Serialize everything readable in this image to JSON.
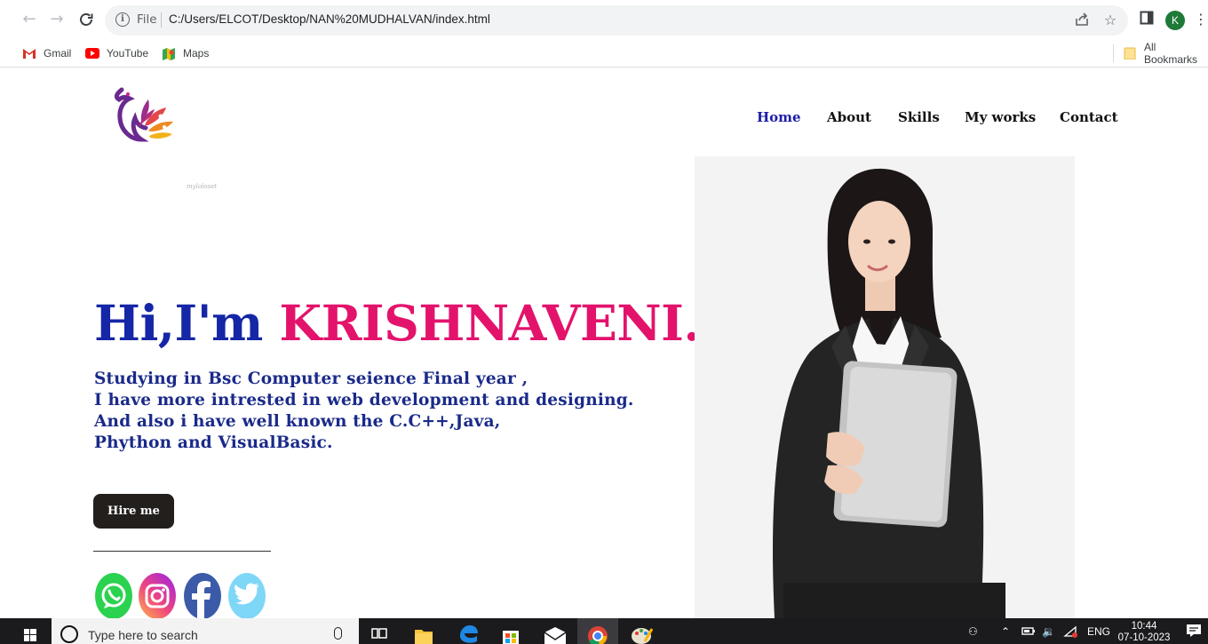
{
  "browser": {
    "scheme_label": "File",
    "url": "C:/Users/ELCOT/Desktop/NAN%20MUDHALVAN/index.html",
    "profile_initial": "K",
    "bookmarks": [
      {
        "label": "Gmail",
        "icon": "gmail-icon"
      },
      {
        "label": "YouTube",
        "icon": "youtube-icon"
      },
      {
        "label": "Maps",
        "icon": "maps-icon"
      }
    ],
    "all_bookmarks_label": "All Bookmarks"
  },
  "site": {
    "nav": [
      {
        "label": "Home",
        "active": true
      },
      {
        "label": "About",
        "active": false
      },
      {
        "label": "Skills",
        "active": false
      },
      {
        "label": "My works",
        "active": false
      },
      {
        "label": "Contact",
        "active": false
      }
    ],
    "logo_caption": "myloloset",
    "hero": {
      "greeting": "Hi,I'm ",
      "name": "KRISHNAVENI.A",
      "lines": [
        "Studying in Bsc Computer seience Final year ,",
        "I have more intrested in web development and designing.",
        "And also i have well known the C.C++,Java,",
        "Phython and VisualBasic."
      ],
      "cta_label": "Hire me"
    },
    "social": [
      "whatsapp-icon",
      "instagram-icon",
      "facebook-icon",
      "twitter-icon"
    ],
    "colors": {
      "greeting": "#1526a6",
      "name": "#e3136c",
      "description": "#1a2a8a",
      "nav_active": "#1c1ca8",
      "cta_background": "#221f1d"
    }
  },
  "taskbar": {
    "search_placeholder": "Type here to search",
    "language": "ENG",
    "time": "10:44",
    "date": "07-10-2023"
  }
}
